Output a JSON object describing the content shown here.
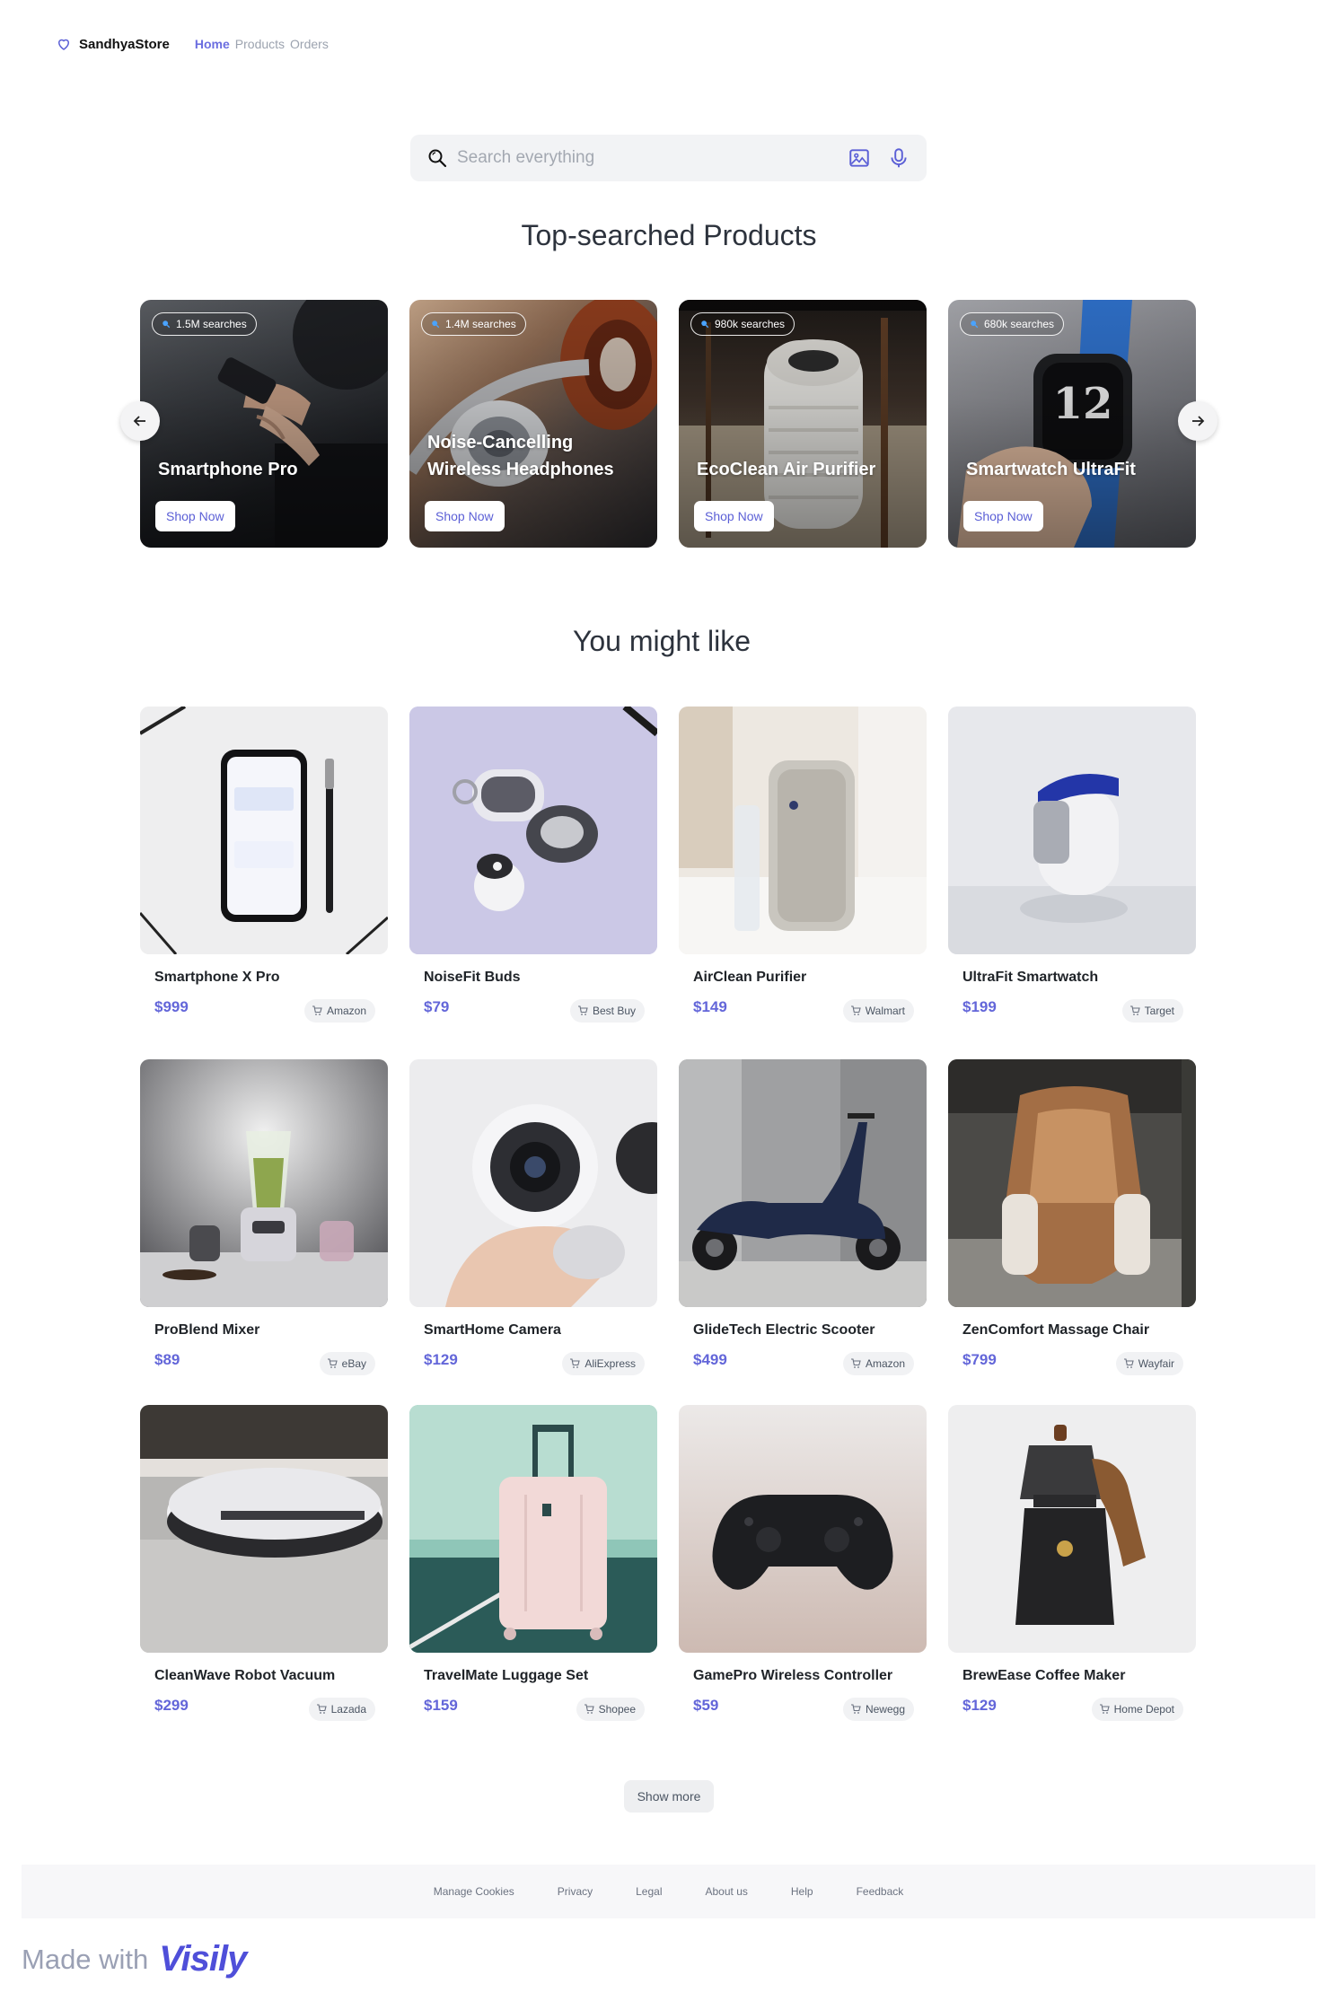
{
  "nav": {
    "brand": "SandhyaStore",
    "links": [
      {
        "label": "Home",
        "active": true
      },
      {
        "label": "Products",
        "active": false
      },
      {
        "label": "Orders",
        "active": false
      }
    ]
  },
  "search": {
    "placeholder": "Search everything",
    "lead_icon": "search-icon",
    "image_icon": "image-search-icon",
    "voice_icon": "microphone-icon"
  },
  "top_section": {
    "title": "Top-searched Products",
    "items": [
      {
        "name": "Smartphone Pro",
        "searches": "1.5M searches",
        "button": "Shop Now"
      },
      {
        "name": "Noise-Cancelling Wireless Headphones",
        "searches": "1.4M searches",
        "button": "Shop Now"
      },
      {
        "name": "EcoClean Air Purifier",
        "searches": "980k searches",
        "button": "Shop Now"
      },
      {
        "name": "Smartwatch UltraFit",
        "searches": "680k searches",
        "button": "Shop Now"
      }
    ]
  },
  "like_section": {
    "title": "You might like",
    "items": [
      {
        "name": "Smartphone X Pro",
        "price": "$999",
        "store": "Amazon"
      },
      {
        "name": "NoiseFit Buds",
        "price": "$79",
        "store": "Best Buy"
      },
      {
        "name": "AirClean Purifier",
        "price": "$149",
        "store": "Walmart"
      },
      {
        "name": "UltraFit Smartwatch",
        "price": "$199",
        "store": "Target"
      },
      {
        "name": "ProBlend Mixer",
        "price": "$89",
        "store": "eBay"
      },
      {
        "name": "SmartHome Camera",
        "price": "$129",
        "store": "AliExpress"
      },
      {
        "name": "GlideTech Electric Scooter",
        "price": "$499",
        "store": "Amazon"
      },
      {
        "name": "ZenComfort Massage Chair",
        "price": "$799",
        "store": "Wayfair"
      },
      {
        "name": "CleanWave Robot Vacuum",
        "price": "$299",
        "store": "Lazada"
      },
      {
        "name": "TravelMate Luggage Set",
        "price": "$159",
        "store": "Shopee"
      },
      {
        "name": "GamePro Wireless Controller",
        "price": "$59",
        "store": "Newegg"
      },
      {
        "name": "BrewEase Coffee Maker",
        "price": "$129",
        "store": "Home Depot"
      }
    ],
    "show_more": "Show more"
  },
  "footer": {
    "links": [
      "Manage Cookies",
      "Privacy",
      "Legal",
      "About us",
      "Help",
      "Feedback"
    ]
  },
  "made_with": {
    "text": "Made with",
    "logo": "Visily"
  },
  "colors": {
    "accent": "#6366d9",
    "nav_active": "#6b6ee0",
    "search_bg": "#f2f3f5"
  }
}
